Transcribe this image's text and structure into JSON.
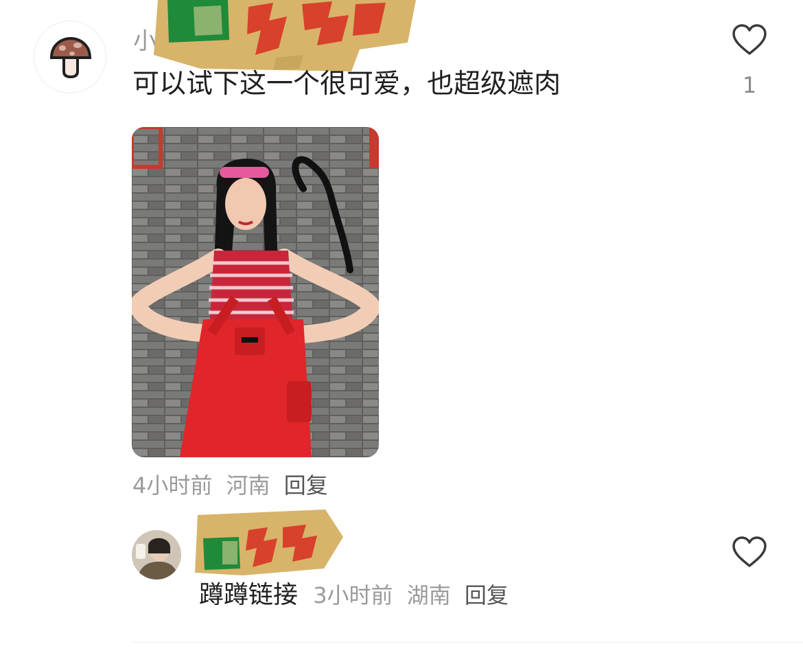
{
  "comment": {
    "username_visible": "小",
    "text": "可以试下这一个很可爱，也超级遮肉",
    "like_count": "1",
    "time": "4小时前",
    "location": "河南",
    "reply_label": "回复"
  },
  "sub_comment": {
    "text": "蹲蹲链接",
    "time": "3小时前",
    "location": "湖南",
    "reply_label": "回复"
  },
  "icons": {
    "avatar": "mushroom-icon",
    "like": "heart-outline-icon"
  },
  "colors": {
    "sticker_paper": "#d7b46a",
    "sticker_green": "#1f8a3a",
    "sticker_red": "#d8412b",
    "overalls_red": "#e0262a"
  }
}
